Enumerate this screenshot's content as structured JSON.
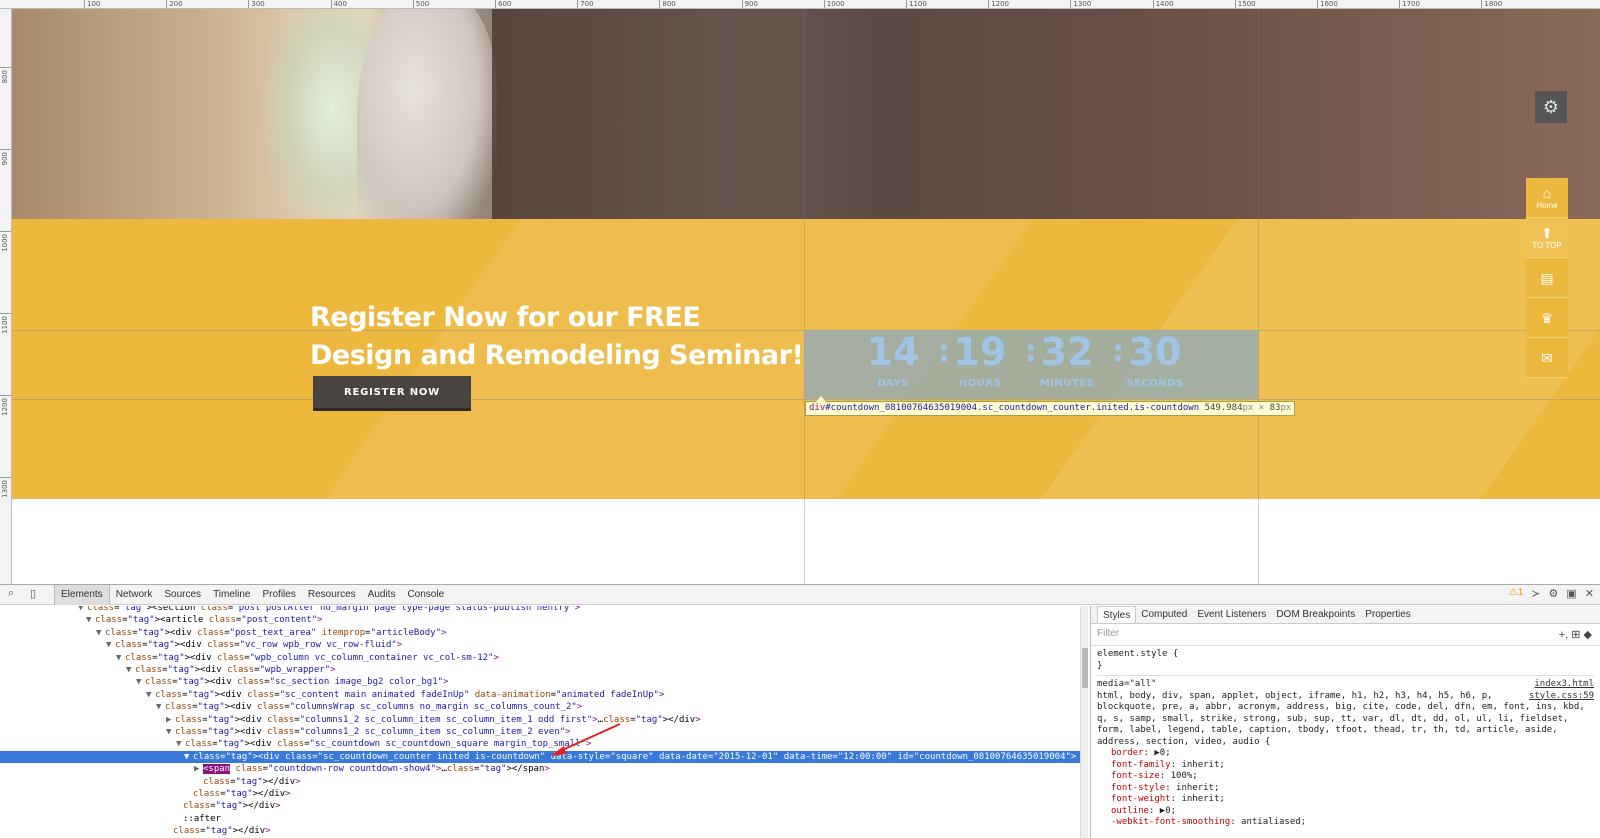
{
  "ruler": {
    "top_ticks": [
      "100",
      "200",
      "300",
      "400",
      "500",
      "600",
      "700",
      "800",
      "900",
      "1000",
      "1100",
      "1200",
      "1300",
      "1400",
      "1500",
      "1600",
      "1700",
      "1800"
    ],
    "left_ticks": [
      "800",
      "900",
      "1000",
      "1100",
      "1200",
      "1300"
    ]
  },
  "page": {
    "headline_line1": "Register Now for our FREE",
    "headline_line2": "Design and Remodeling Seminar!",
    "register_button": "REGISTER NOW",
    "countdown": {
      "days": "14",
      "hours": "19",
      "minutes": "32",
      "seconds": "30",
      "days_label": "DAYS",
      "hours_label": "HOURS",
      "minutes_label": "MINUTES",
      "seconds_label": "SECONDS",
      "separator": ":"
    },
    "tooltip": {
      "tag": "div",
      "selector": "#countdown_081007646350190​04.sc_countdown_counter.inited.is-countdown",
      "width": "549.984",
      "height": "83",
      "unit": "px",
      "times": " × "
    },
    "side_nav": {
      "home": "Home",
      "to_top": "TO TOP"
    }
  },
  "devtools": {
    "tabs": [
      "Elements",
      "Network",
      "Sources",
      "Timeline",
      "Profiles",
      "Resources",
      "Audits",
      "Console"
    ],
    "warning_count": "1",
    "dom_lines": [
      "<section class=\"post postAlter no_margin page type-page status-publish hentry\">",
      "<article class=\"post_content\">",
      "<div class=\"post_text_area\" itemprop=\"articleBody\">",
      "<div class=\"vc_row wpb_row vc_row-fluid\">",
      "<div class=\"wpb_column vc_column_container vc_col-sm-12\">",
      "<div class=\"wpb_wrapper\">",
      "<div class=\"sc_section image_bg2 color_bg1\">",
      "<div class=\"sc_content main animated fadeInUp\" data-animation=\"animated fadeInUp\">",
      "<div class=\"columnsWrap sc_columns no_margin sc_columns_count_2\">",
      "<div class=\"columns1_2 sc_column_item sc_column_item_1 odd first\">…</div>",
      "<div class=\"columns1_2 sc_column_item sc_column_item_2 even\">",
      "<div class=\"sc_countdown  sc_countdown_square margin_top_small\">",
      "<div class=\"sc_countdown_counter inited is-countdown\" data-style=\"square\" data-date=\"2015-12-01\" data-time=\"12:00:00\" id=\"countdown_08100764635019004\">",
      "class=\"countdown-row countdown-show4\">…</span>",
      "</div>",
      "</div>",
      "</div>",
      "::after",
      "</div>"
    ],
    "span_tag": "<span",
    "styles_tabs": [
      "Styles",
      "Computed",
      "Event Listeners",
      "DOM Breakpoints",
      "Properties"
    ],
    "filter_placeholder": "Filter",
    "filter_tools": "+, ⊞ ◆",
    "style_element": "element.style {",
    "style_close": "}",
    "media": "media=\"all\"",
    "file1": "index3.html",
    "file2": "style.css:59",
    "selector_text": "html, body, div, span, applet, object, iframe, h1, h2, h3, h4, h5, h6, p, blockquote, pre, a, abbr, acronym, address, big, cite, code, del, dfn, em, font, ins, kbd, q, s, samp, small, strike, strong, sub, sup, tt, var, dl, dt, dd, ol, ul, li, fieldset, form, label, legend, table, caption, tbody, tfoot, thead, tr, th, td, article, aside, address, section, video, audio {",
    "props": [
      {
        "name": "border",
        "value": "▶0;"
      },
      {
        "name": "font-family",
        "value": "inherit;"
      },
      {
        "name": "font-size",
        "value": "100%;"
      },
      {
        "name": "font-style",
        "value": "inherit;"
      },
      {
        "name": "font-weight",
        "value": "inherit;"
      },
      {
        "name": "outline",
        "value": "▶0;"
      },
      {
        "name": "-webkit-font-smoothing",
        "value": "antialiased;"
      }
    ]
  },
  "colors": {
    "band_yellow": "#edb83e",
    "selection_blue": "#3879d9",
    "countdown_digit": "#9fc4e6"
  }
}
